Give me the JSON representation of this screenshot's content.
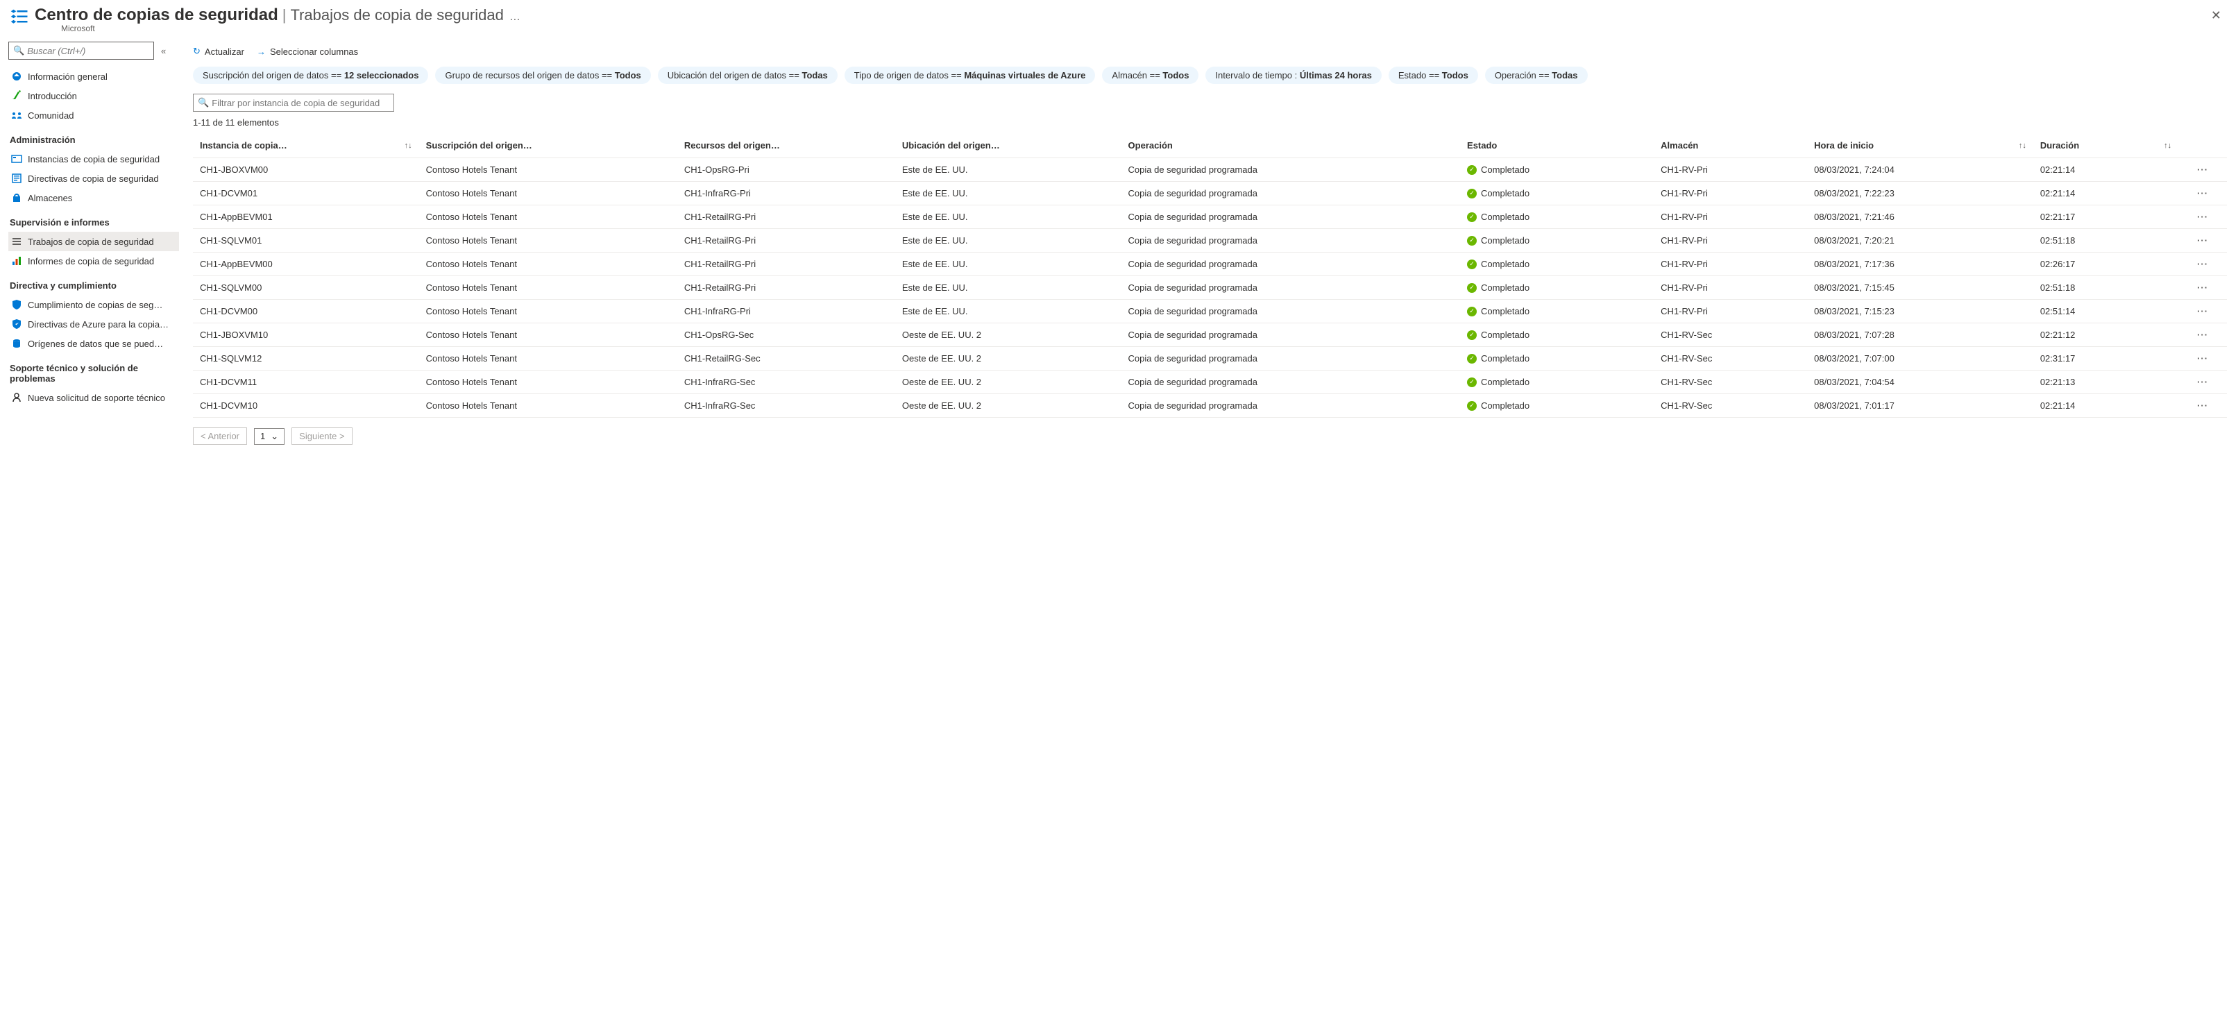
{
  "header": {
    "title": "Centro de copias de seguridad",
    "separator": "|",
    "subtitle": "Trabajos de copia de seguridad",
    "org": "Microsoft",
    "more": "…"
  },
  "sidebar": {
    "search_placeholder": "Buscar (Ctrl+/)",
    "items_top": [
      {
        "label": "Información general",
        "icon": "overview"
      },
      {
        "label": "Introducción",
        "icon": "getstarted"
      },
      {
        "label": "Comunidad",
        "icon": "community"
      }
    ],
    "section_admin": "Administración",
    "items_admin": [
      {
        "label": "Instancias de copia de seguridad",
        "icon": "instances"
      },
      {
        "label": "Directivas de copia de seguridad",
        "icon": "policies"
      },
      {
        "label": "Almacenes",
        "icon": "vaults"
      }
    ],
    "section_monitor": "Supervisión e informes",
    "items_monitor": [
      {
        "label": "Trabajos de copia de seguridad",
        "icon": "jobs",
        "selected": true
      },
      {
        "label": "Informes de copia de seguridad",
        "icon": "reports"
      }
    ],
    "section_policy": "Directiva y cumplimiento",
    "items_policy": [
      {
        "label": "Cumplimiento de copias de seg…",
        "icon": "compliance"
      },
      {
        "label": "Directivas de Azure para la copia…",
        "icon": "azurepolicy"
      },
      {
        "label": "Orígenes de datos que se pued…",
        "icon": "datasources"
      }
    ],
    "section_support": "Soporte técnico y solución de problemas",
    "items_support": [
      {
        "label": "Nueva solicitud de soporte técnico",
        "icon": "support"
      }
    ]
  },
  "toolbar": {
    "refresh": "Actualizar",
    "columns": "Seleccionar columnas"
  },
  "filters": [
    {
      "prefix": "Suscripción del origen de datos == ",
      "value": "12 seleccionados"
    },
    {
      "prefix": "Grupo de recursos del origen de datos == ",
      "value": "Todos"
    },
    {
      "prefix": "Ubicación del origen de datos == ",
      "value": "Todas"
    },
    {
      "prefix": "Tipo de origen de datos == ",
      "value": "Máquinas virtuales de Azure"
    },
    {
      "prefix": "Almacén == ",
      "value": "Todos"
    },
    {
      "prefix": "Intervalo de tiempo : ",
      "value": "Últimas 24 horas"
    },
    {
      "prefix": "Estado == ",
      "value": "Todos"
    },
    {
      "prefix": "Operación == ",
      "value": "Todas"
    }
  ],
  "filter_placeholder": "Filtrar por instancia de copia de seguridad",
  "count_text": "1-11 de 11 elementos",
  "columns": {
    "c0": "Instancia de copia…",
    "c1": "Suscripción del origen…",
    "c2": "Recursos del origen…",
    "c3": "Ubicación del origen…",
    "c4": "Operación",
    "c5": "Estado",
    "c6": "Almacén",
    "c7": "Hora de inicio",
    "c8": "Duración"
  },
  "rows": [
    {
      "c0": "CH1-JBOXVM00",
      "c1": "Contoso Hotels Tenant",
      "c2": "CH1-OpsRG-Pri",
      "c3": "Este de EE. UU.",
      "c4": "Copia de seguridad programada",
      "c5": "Completado",
      "c6": "CH1-RV-Pri",
      "c7": "08/03/2021, 7:24:04",
      "c8": "02:21:14"
    },
    {
      "c0": "CH1-DCVM01",
      "c1": "Contoso Hotels Tenant",
      "c2": "CH1-InfraRG-Pri",
      "c3": "Este de EE. UU.",
      "c4": "Copia de seguridad programada",
      "c5": "Completado",
      "c6": "CH1-RV-Pri",
      "c7": "08/03/2021, 7:22:23",
      "c8": "02:21:14"
    },
    {
      "c0": "CH1-AppBEVM01",
      "c1": "Contoso Hotels Tenant",
      "c2": "CH1-RetailRG-Pri",
      "c3": "Este de EE. UU.",
      "c4": "Copia de seguridad programada",
      "c5": "Completado",
      "c6": "CH1-RV-Pri",
      "c7": "08/03/2021, 7:21:46",
      "c8": "02:21:17"
    },
    {
      "c0": "CH1-SQLVM01",
      "c1": "Contoso Hotels Tenant",
      "c2": "CH1-RetailRG-Pri",
      "c3": "Este de EE. UU.",
      "c4": "Copia de seguridad programada",
      "c5": "Completado",
      "c6": "CH1-RV-Pri",
      "c7": "08/03/2021, 7:20:21",
      "c8": "02:51:18"
    },
    {
      "c0": "CH1-AppBEVM00",
      "c1": "Contoso Hotels Tenant",
      "c2": "CH1-RetailRG-Pri",
      "c3": "Este de EE. UU.",
      "c4": "Copia de seguridad programada",
      "c5": "Completado",
      "c6": "CH1-RV-Pri",
      "c7": "08/03/2021, 7:17:36",
      "c8": "02:26:17"
    },
    {
      "c0": "CH1-SQLVM00",
      "c1": "Contoso Hotels Tenant",
      "c2": "CH1-RetailRG-Pri",
      "c3": "Este de EE. UU.",
      "c4": "Copia de seguridad programada",
      "c5": "Completado",
      "c6": "CH1-RV-Pri",
      "c7": "08/03/2021, 7:15:45",
      "c8": "02:51:18"
    },
    {
      "c0": "CH1-DCVM00",
      "c1": "Contoso Hotels Tenant",
      "c2": "CH1-InfraRG-Pri",
      "c3": "Este de EE. UU.",
      "c4": "Copia de seguridad programada",
      "c5": "Completado",
      "c6": "CH1-RV-Pri",
      "c7": "08/03/2021, 7:15:23",
      "c8": "02:51:14"
    },
    {
      "c0": "CH1-JBOXVM10",
      "c1": "Contoso Hotels Tenant",
      "c2": "CH1-OpsRG-Sec",
      "c3": "Oeste de EE. UU. 2",
      "c4": "Copia de seguridad programada",
      "c5": "Completado",
      "c6": "CH1-RV-Sec",
      "c7": "08/03/2021, 7:07:28",
      "c8": "02:21:12"
    },
    {
      "c0": "CH1-SQLVM12",
      "c1": "Contoso Hotels Tenant",
      "c2": "CH1-RetailRG-Sec",
      "c3": "Oeste de EE. UU. 2",
      "c4": "Copia de seguridad programada",
      "c5": "Completado",
      "c6": "CH1-RV-Sec",
      "c7": "08/03/2021, 7:07:00",
      "c8": "02:31:17"
    },
    {
      "c0": "CH1-DCVM11",
      "c1": "Contoso Hotels Tenant",
      "c2": "CH1-InfraRG-Sec",
      "c3": "Oeste de EE. UU. 2",
      "c4": "Copia de seguridad programada",
      "c5": "Completado",
      "c6": "CH1-RV-Sec",
      "c7": "08/03/2021, 7:04:54",
      "c8": "02:21:13"
    },
    {
      "c0": "CH1-DCVM10",
      "c1": "Contoso Hotels Tenant",
      "c2": "CH1-InfraRG-Sec",
      "c3": "Oeste de EE. UU. 2",
      "c4": "Copia de seguridad programada",
      "c5": "Completado",
      "c6": "CH1-RV-Sec",
      "c7": "08/03/2021, 7:01:17",
      "c8": "02:21:14"
    }
  ],
  "pager": {
    "prev": "< Anterior",
    "page": "1",
    "next": "Siguiente >"
  }
}
